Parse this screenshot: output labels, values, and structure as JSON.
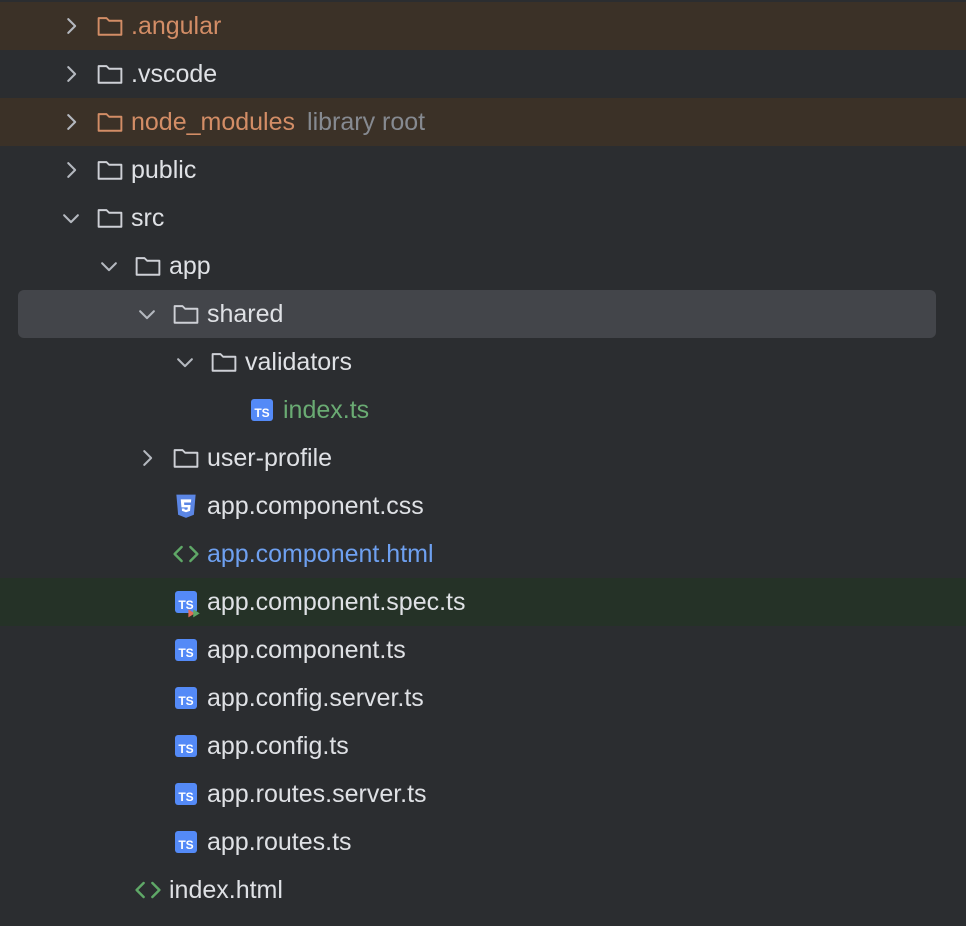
{
  "project_tree": {
    "rows": [
      {
        "label": ".angular",
        "type": "folder",
        "expanded": false,
        "status": "excluded"
      },
      {
        "label": ".vscode",
        "type": "folder",
        "expanded": false,
        "status": "normal"
      },
      {
        "label": "node_modules",
        "hint": "library root",
        "type": "folder",
        "expanded": false,
        "status": "excluded"
      },
      {
        "label": "public",
        "type": "folder",
        "expanded": false,
        "status": "normal"
      },
      {
        "label": "src",
        "type": "folder",
        "expanded": true,
        "status": "normal"
      },
      {
        "label": "app",
        "type": "folder",
        "expanded": true,
        "status": "normal"
      },
      {
        "label": "shared",
        "type": "folder",
        "expanded": true,
        "status": "selected"
      },
      {
        "label": "validators",
        "type": "folder",
        "expanded": true,
        "status": "normal"
      },
      {
        "label": "index.ts",
        "type": "ts-file",
        "icon_text": "TS",
        "status": "added"
      },
      {
        "label": "user-profile",
        "type": "folder",
        "expanded": false,
        "status": "normal"
      },
      {
        "label": "app.component.css",
        "type": "css-file",
        "status": "normal"
      },
      {
        "label": "app.component.html",
        "type": "html-file",
        "status": "modified"
      },
      {
        "label": "app.component.spec.ts",
        "type": "ts-test-file",
        "icon_text": "TS",
        "status": "normal"
      },
      {
        "label": "app.component.ts",
        "type": "ts-file",
        "icon_text": "TS",
        "status": "normal"
      },
      {
        "label": "app.config.server.ts",
        "type": "ts-file",
        "icon_text": "TS",
        "status": "normal"
      },
      {
        "label": "app.config.ts",
        "type": "ts-file",
        "icon_text": "TS",
        "status": "normal"
      },
      {
        "label": "app.routes.server.ts",
        "type": "ts-file",
        "icon_text": "TS",
        "status": "normal"
      },
      {
        "label": "app.routes.ts",
        "type": "ts-file",
        "icon_text": "TS",
        "status": "normal"
      },
      {
        "label": "index.html",
        "type": "html-file",
        "status": "normal"
      }
    ]
  },
  "colors": {
    "background": "#2b2d30",
    "excluded_row": "#3b3127",
    "excluded_text": "#d38d66",
    "selected_row": "#43454a",
    "tested_row": "#253227",
    "added_text": "#6aab73",
    "modified_text": "#6ea0f0",
    "ts_badge": "#548af7",
    "css_badge": "#5b86e5",
    "html_icon": "#5fa867"
  }
}
